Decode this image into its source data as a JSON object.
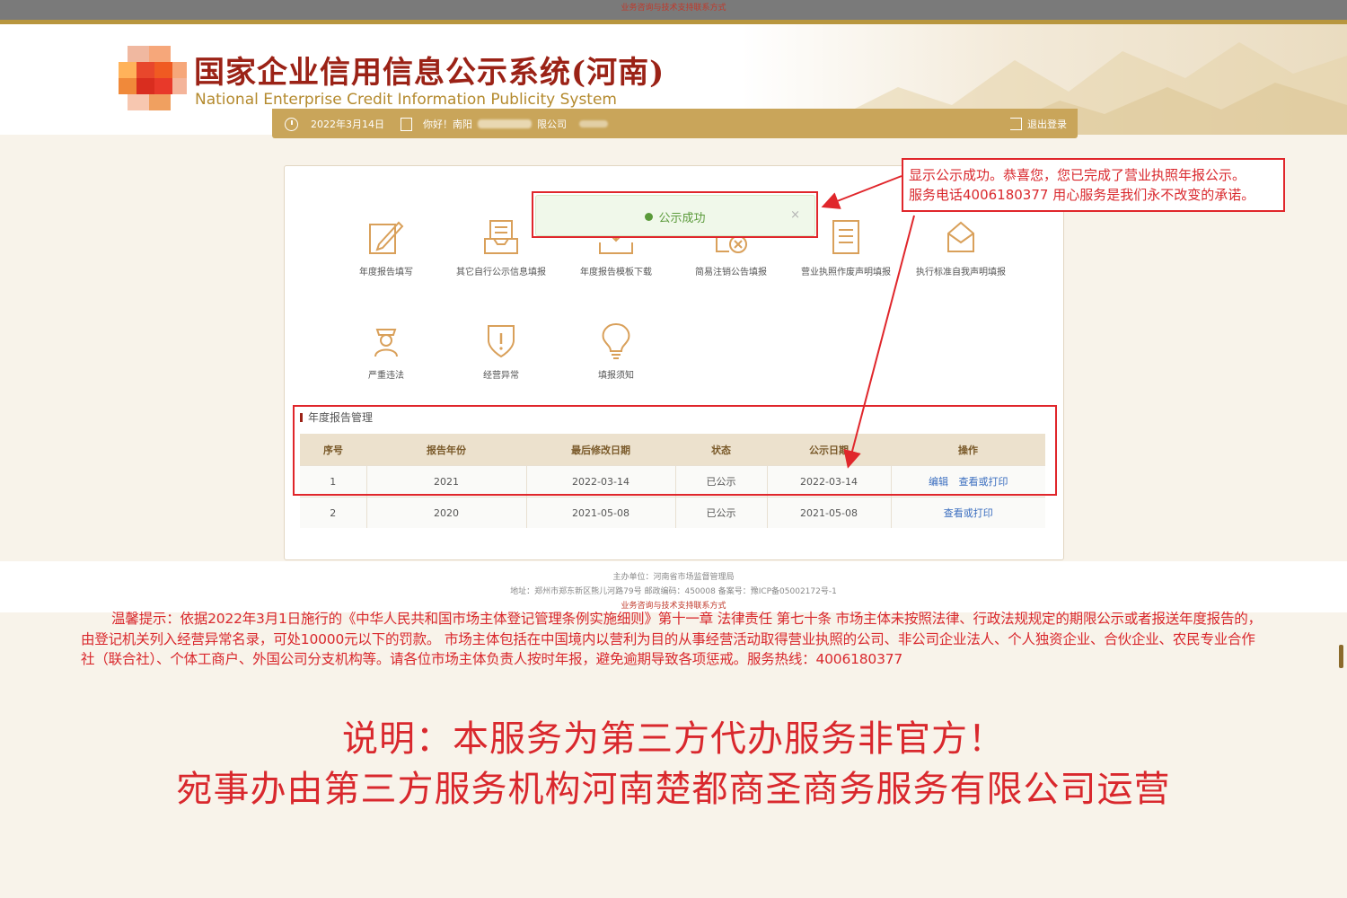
{
  "top_strip": {
    "link": "业务咨询与技术支持联系方式"
  },
  "header": {
    "title": "国家企业信用信息公示系统(河南)",
    "subtitle": "National Enterprise Credit Information Publicity System",
    "date": "2022年3月14日",
    "greeting_prefix": "你好！南阳",
    "greeting_suffix": "限公司",
    "logout": "退出登录"
  },
  "toast": {
    "message": "公示成功",
    "close": "×"
  },
  "tiles": [
    {
      "label": "年度报告填写",
      "icon": "edit-form-icon"
    },
    {
      "label": "其它自行公示信息填报",
      "icon": "inbox-tray-icon"
    },
    {
      "label": "年度报告模板下载",
      "icon": "download-tray-icon"
    },
    {
      "label": "简易注销公告填报",
      "icon": "cancel-doc-icon"
    },
    {
      "label": "营业执照作废声明填报",
      "icon": "document-icon"
    },
    {
      "label": "执行标准自我声明填报",
      "icon": "envelope-icon"
    },
    {
      "label": "严重违法",
      "icon": "officer-icon"
    },
    {
      "label": "经营异常",
      "icon": "shield-alert-icon"
    },
    {
      "label": "填报须知",
      "icon": "lightbulb-icon"
    }
  ],
  "section_title": "年度报告管理",
  "table": {
    "headers": [
      "序号",
      "报告年份",
      "最后修改日期",
      "状态",
      "公示日期",
      "操作"
    ],
    "rows": [
      {
        "no": "1",
        "year": "2021",
        "modified": "2022-03-14",
        "status": "已公示",
        "published": "2022-03-14",
        "edit": "编辑",
        "view": "查看或打印"
      },
      {
        "no": "2",
        "year": "2020",
        "modified": "2021-05-08",
        "status": "已公示",
        "published": "2021-05-08",
        "edit": "",
        "view": "查看或打印"
      }
    ]
  },
  "callout": {
    "line1": "显示公示成功。恭喜您，您已完成了营业执照年报公示。",
    "line2": "服务电话4006180377 用心服务是我们永不改变的承诺。"
  },
  "footer": {
    "line1": "主办单位：河南省市场监督管理局",
    "line2": "地址：郑州市郑东新区熊儿河路79号 邮政编码：450008 备案号：豫ICP备05002172号-1",
    "line3": "业务咨询与技术支持联系方式"
  },
  "notice": "温馨提示：依据2022年3月1日施行的《中华人民共和国市场主体登记管理条例实施细则》第十一章 法律责任 第七十条 市场主体未按照法律、行政法规规定的期限公示或者报送年度报告的，由登记机关列入经营异常名录，可处10000元以下的罚款。 市场主体包括在中国境内以营利为目的从事经营活动取得营业执照的公司、非公司企业法人、个人独资企业、合伙企业、农民专业合作社（联合社）、个体工商户、外国公司分支机构等。请各位市场主体负责人按时年报，避免逾期导致各项惩戒。服务热线：4006180377",
  "disclaimer": {
    "line1": "说明：本服务为第三方代办服务非官方！",
    "line2": "宛事办由第三方服务机构河南楚都商圣商务服务有限公司运营"
  },
  "colors": {
    "accent": "#c9a55a",
    "brand_red": "#9b2216",
    "alert_red": "#e0262b"
  }
}
